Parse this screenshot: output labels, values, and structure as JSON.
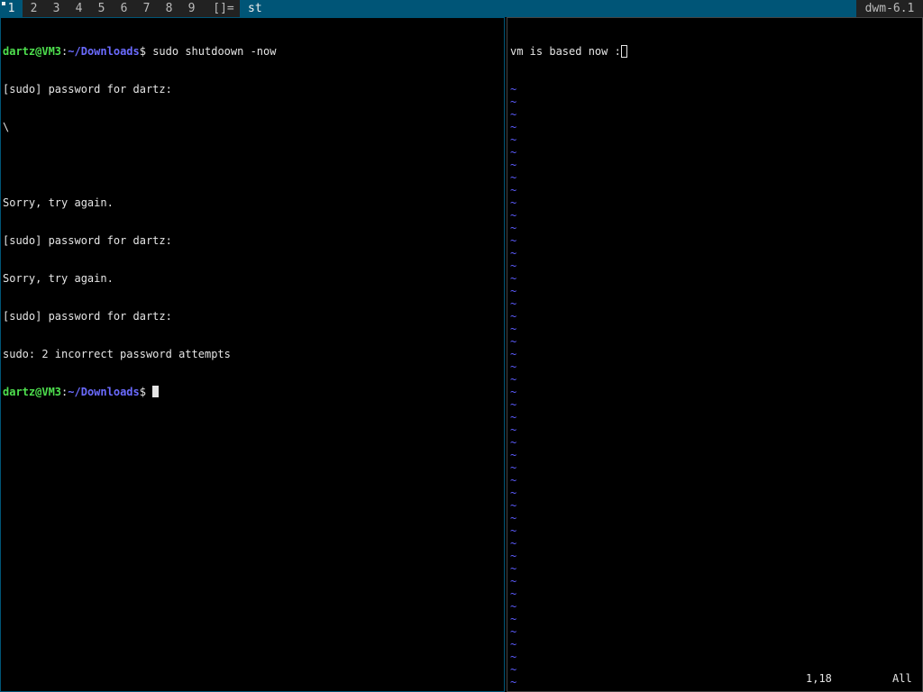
{
  "bar": {
    "tags": [
      "1",
      "2",
      "3",
      "4",
      "5",
      "6",
      "7",
      "8",
      "9"
    ],
    "selected_tag": "1",
    "layout_symbol": "[]=",
    "window_title": "st",
    "status_text": "dwm-6.1",
    "colors": {
      "bar_bg": "#222222",
      "bar_fg": "#bbbbbb",
      "selected_bg": "#005577",
      "selected_fg": "#eeeeee"
    }
  },
  "terminal": {
    "prompt_user_host": "dartz@VM3",
    "prompt_colon": ":",
    "prompt_path": "~/Downloads",
    "prompt_symbol": "$ ",
    "command": "sudo shutdoown -now",
    "output_lines": [
      "[sudo] password for dartz:",
      "\\",
      "",
      "Sorry, try again.",
      "[sudo] password for dartz:",
      "Sorry, try again.",
      "[sudo] password for dartz:",
      "sudo: 2 incorrect password attempts"
    ],
    "colors": {
      "user_host": "#4ee04e",
      "path": "#6b6bff",
      "text": "#e5e5e5"
    }
  },
  "vim": {
    "first_line": "vm is based now :",
    "cursor_char": ")",
    "empty_line_marker": "~",
    "cursor_position": "1,18",
    "scroll_indicator": "All",
    "colors": {
      "tilde": "#5c5cff"
    }
  }
}
